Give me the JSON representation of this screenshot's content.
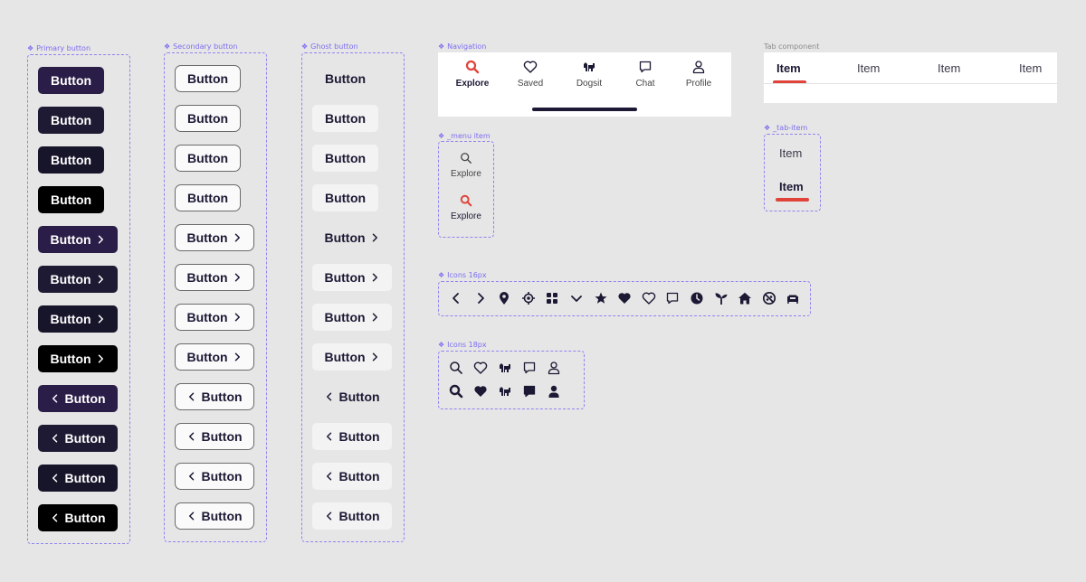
{
  "frames": {
    "primary": "Primary button",
    "secondary": "Secondary button",
    "ghost": "Ghost button",
    "navigation": "Navigation",
    "menu_item": "_menu item",
    "icons16": "Icons 16px",
    "icons18": "Icons 18px",
    "tab_component": "Tab component",
    "tab_item": "_tab-item"
  },
  "button_label": "Button",
  "primary_colors": [
    "#2a1d47",
    "#1f1a33",
    "#17152a",
    "#000000"
  ],
  "navigation": {
    "items": [
      {
        "label": "Explore",
        "icon": "search-icon",
        "active": true
      },
      {
        "label": "Saved",
        "icon": "heart-icon",
        "active": false
      },
      {
        "label": "Dogsit",
        "icon": "dogsit-icon",
        "active": false
      },
      {
        "label": "Chat",
        "icon": "chat-icon",
        "active": false
      },
      {
        "label": "Profile",
        "icon": "profile-icon",
        "active": false
      }
    ],
    "accent": "#e0433a"
  },
  "menu_item": {
    "items": [
      {
        "label": "Explore",
        "state": "default"
      },
      {
        "label": "Explore",
        "state": "active"
      }
    ]
  },
  "tab_component": {
    "tabs": [
      "Item",
      "Item",
      "Item",
      "Item"
    ],
    "active_index": 0
  },
  "tab_item": {
    "items": [
      "Item",
      "Item"
    ]
  },
  "icons16": [
    "chevron-left-icon",
    "chevron-right-icon",
    "location-pin-icon",
    "target-icon",
    "grid-icon",
    "chevron-down-icon",
    "star-icon",
    "heart-filled-icon",
    "heart-outline-icon",
    "chat-icon",
    "clock-icon",
    "sprout-icon",
    "home-icon",
    "no-pets-icon",
    "sofa-icon"
  ],
  "icons18": {
    "outline": [
      "search-icon",
      "heart-icon",
      "dogsit-icon",
      "chat-icon",
      "profile-icon"
    ],
    "filled": [
      "search-filled-icon",
      "heart-filled-icon",
      "dogsit-icon",
      "chat-filled-icon",
      "profile-filled-icon"
    ]
  }
}
